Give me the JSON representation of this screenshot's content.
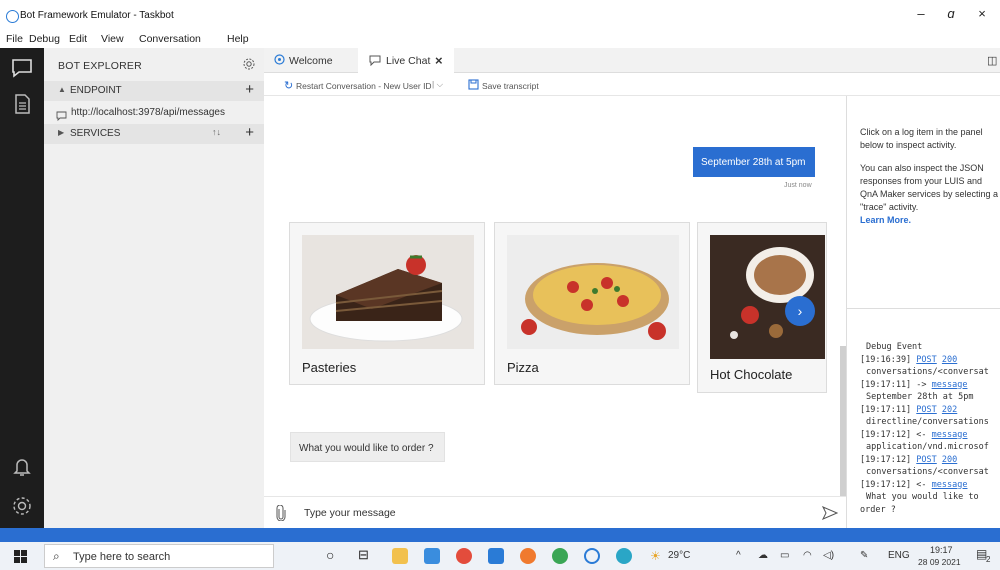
{
  "window": {
    "title": "Bot Framework Emulator - Taskbot",
    "minimize": "–",
    "maximize": "ɑ",
    "close": "×"
  },
  "menu": [
    "File",
    "Debug",
    "Edit",
    "View",
    "Conversation",
    "Help"
  ],
  "explorer": {
    "title": "BOT EXPLORER",
    "endpoint_label": "ENDPOINT",
    "endpoint_url": "http://localhost:3978/api/messages",
    "services_label": "SERVICES"
  },
  "tabs": [
    {
      "label": "Welcome"
    },
    {
      "label": "Live Chat"
    }
  ],
  "toolbar": {
    "restart_label": "Restart Conversation - New User ID",
    "save_label": "Save transcript"
  },
  "chat": {
    "user_message": "September 28th at 5pm",
    "timestamp": "Just now",
    "cards": [
      {
        "caption": "Pasteries"
      },
      {
        "caption": "Pizza"
      },
      {
        "caption": "Hot Chocolate"
      }
    ],
    "bot_message": "What you would like to order ?",
    "input_placeholder": "Type your message"
  },
  "inspector": {
    "para1": "Click on a log item in the panel below to inspect activity.",
    "para2": "You can also inspect the JSON responses from your LUIS and QnA Maker services by selecting a \"trace\" activity.",
    "learn_more": "Learn More."
  },
  "log": [
    {
      "kind": "sub",
      "text": "Debug Event"
    },
    {
      "kind": "entry",
      "time": "[19:16:39]",
      "method": "POST",
      "status": "200"
    },
    {
      "kind": "sub",
      "text": "conversations/<conversat"
    },
    {
      "kind": "entry",
      "time": "[19:17:11]",
      "arrow": "->",
      "method": "message"
    },
    {
      "kind": "sub",
      "text": "September 28th at 5pm"
    },
    {
      "kind": "entry",
      "time": "[19:17:11]",
      "method": "POST",
      "status": "202"
    },
    {
      "kind": "sub",
      "text": "directline/conversations"
    },
    {
      "kind": "entry",
      "time": "[19:17:12]",
      "arrow": "<-",
      "method": "message"
    },
    {
      "kind": "sub",
      "text": "application/vnd.microsof"
    },
    {
      "kind": "entry",
      "time": "[19:17:12]",
      "method": "POST",
      "status": "200"
    },
    {
      "kind": "sub",
      "text": "conversations/<conversat"
    },
    {
      "kind": "entry",
      "time": "[19:17:12]",
      "arrow": "<-",
      "method": "message"
    },
    {
      "kind": "sub",
      "text": "What you would like to"
    },
    {
      "kind": "plain",
      "text": "order ?"
    }
  ],
  "taskbar": {
    "search_placeholder": "Type here to search",
    "weather": "29°C",
    "language": "ENG",
    "time": "19:17",
    "date": "28 09 2021",
    "notifications": "2"
  },
  "colors": {
    "accent": "#2a6ed1",
    "activity_bar": "#1d1d1d",
    "explorer_bg": "#f0f0f0"
  }
}
